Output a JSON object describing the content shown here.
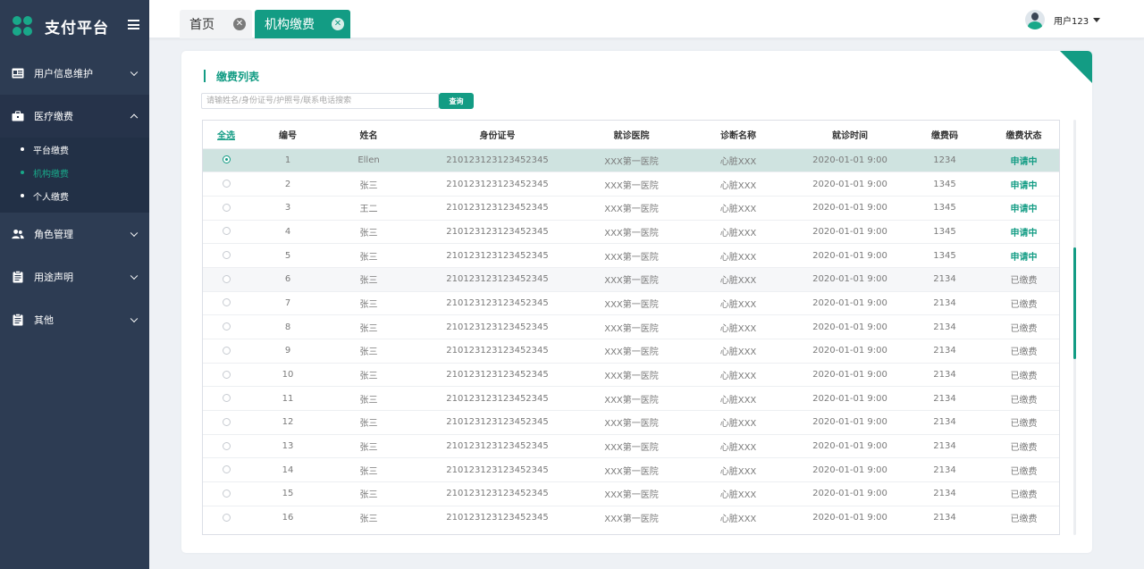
{
  "brand": {
    "title": "支付平台",
    "logo_icon": "clover-logo-icon"
  },
  "colors": {
    "accent": "#139c84",
    "sidebar": "#2d3c53"
  },
  "sidebar": {
    "items": [
      {
        "label": "用户信息维护",
        "icon": "id-card-icon"
      },
      {
        "label": "医疗缴费",
        "icon": "briefcase-icon",
        "expanded": true,
        "children": [
          {
            "label": "平台缴费"
          },
          {
            "label": "机构缴费",
            "active": true
          },
          {
            "label": "个人缴费"
          }
        ]
      },
      {
        "label": "角色管理",
        "icon": "users-icon"
      },
      {
        "label": "用途声明",
        "icon": "clipboard-icon"
      },
      {
        "label": "其他",
        "icon": "clipboard-icon"
      }
    ]
  },
  "tabs": [
    {
      "label": "首页"
    },
    {
      "label": "机构缴费",
      "active": true
    }
  ],
  "user": {
    "name": "用户123"
  },
  "main": {
    "section_title": "缴费列表",
    "search_placeholder": "请输姓名/身份证号/护照号/联系电话搜索",
    "search_button": "查询"
  },
  "table": {
    "headers": [
      "全选",
      "编号",
      "姓名",
      "身份证号",
      "就诊医院",
      "诊断名称",
      "就诊时间",
      "缴费码",
      "缴费状态"
    ],
    "rows": [
      {
        "selected": true,
        "id": "1",
        "name": "Ellen",
        "id_number": "210123123123452345",
        "hospital": "XXX第一医院",
        "diagnosis": "心脏XXX",
        "time": "2020-01-01 9:00",
        "code": "1234",
        "status": "申请中"
      },
      {
        "id": "2",
        "name": "张三",
        "id_number": "210123123123452345",
        "hospital": "XXX第一医院",
        "diagnosis": "心脏XXX",
        "time": "2020-01-01 9:00",
        "code": "1345",
        "status": "申请中"
      },
      {
        "id": "3",
        "name": "王二",
        "id_number": "210123123123452345",
        "hospital": "XXX第一医院",
        "diagnosis": "心脏XXX",
        "time": "2020-01-01 9:00",
        "code": "1345",
        "status": "申请中"
      },
      {
        "id": "4",
        "name": "张三",
        "id_number": "210123123123452345",
        "hospital": "XXX第一医院",
        "diagnosis": "心脏XXX",
        "time": "2020-01-01 9:00",
        "code": "1345",
        "status": "申请中"
      },
      {
        "id": "5",
        "name": "张三",
        "id_number": "210123123123452345",
        "hospital": "XXX第一医院",
        "diagnosis": "心脏XXX",
        "time": "2020-01-01 9:00",
        "code": "1345",
        "status": "申请中"
      },
      {
        "id": "6",
        "name": "张三",
        "id_number": "210123123123452345",
        "hospital": "XXX第一医院",
        "diagnosis": "心脏XXX",
        "time": "2020-01-01 9:00",
        "code": "2134",
        "status": "已缴费",
        "highlight": true
      },
      {
        "id": "7",
        "name": "张三",
        "id_number": "210123123123452345",
        "hospital": "XXX第一医院",
        "diagnosis": "心脏XXX",
        "time": "2020-01-01 9:00",
        "code": "2134",
        "status": "已缴费"
      },
      {
        "id": "8",
        "name": "张三",
        "id_number": "210123123123452345",
        "hospital": "XXX第一医院",
        "diagnosis": "心脏XXX",
        "time": "2020-01-01 9:00",
        "code": "2134",
        "status": "已缴费"
      },
      {
        "id": "9",
        "name": "张三",
        "id_number": "210123123123452345",
        "hospital": "XXX第一医院",
        "diagnosis": "心脏XXX",
        "time": "2020-01-01 9:00",
        "code": "2134",
        "status": "已缴费"
      },
      {
        "id": "10",
        "name": "张三",
        "id_number": "210123123123452345",
        "hospital": "XXX第一医院",
        "diagnosis": "心脏XXX",
        "time": "2020-01-01 9:00",
        "code": "2134",
        "status": "已缴费"
      },
      {
        "id": "11",
        "name": "张三",
        "id_number": "210123123123452345",
        "hospital": "XXX第一医院",
        "diagnosis": "心脏XXX",
        "time": "2020-01-01 9:00",
        "code": "2134",
        "status": "已缴费"
      },
      {
        "id": "12",
        "name": "张三",
        "id_number": "210123123123452345",
        "hospital": "XXX第一医院",
        "diagnosis": "心脏XXX",
        "time": "2020-01-01 9:00",
        "code": "2134",
        "status": "已缴费"
      },
      {
        "id": "13",
        "name": "张三",
        "id_number": "210123123123452345",
        "hospital": "XXX第一医院",
        "diagnosis": "心脏XXX",
        "time": "2020-01-01 9:00",
        "code": "2134",
        "status": "已缴费"
      },
      {
        "id": "14",
        "name": "张三",
        "id_number": "210123123123452345",
        "hospital": "XXX第一医院",
        "diagnosis": "心脏XXX",
        "time": "2020-01-01 9:00",
        "code": "2134",
        "status": "已缴费"
      },
      {
        "id": "15",
        "name": "张三",
        "id_number": "210123123123452345",
        "hospital": "XXX第一医院",
        "diagnosis": "心脏XXX",
        "time": "2020-01-01 9:00",
        "code": "2134",
        "status": "已缴费"
      },
      {
        "id": "16",
        "name": "张三",
        "id_number": "210123123123452345",
        "hospital": "XXX第一医院",
        "diagnosis": "心脏XXX",
        "time": "2020-01-01 9:00",
        "code": "2134",
        "status": "已缴费"
      }
    ]
  }
}
